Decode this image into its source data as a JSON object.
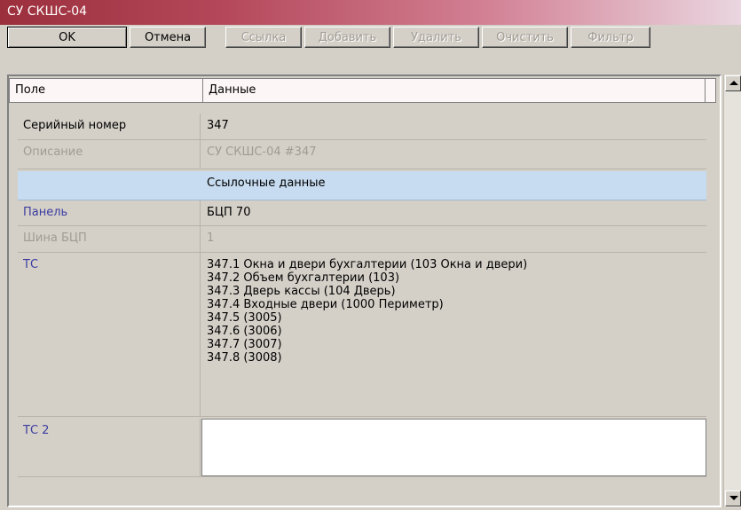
{
  "window": {
    "title": "СУ СКШС-04"
  },
  "toolbar": {
    "ok": "OK",
    "cancel": "Отмена",
    "link": "Ссылка",
    "add": "Добавить",
    "delete": "Удалить",
    "clear": "Очистить",
    "filter": "Фильтр"
  },
  "grid": {
    "header": {
      "field": "Поле",
      "data": "Данные"
    },
    "rows": {
      "serial": {
        "field": "Серийный номер",
        "value": "347"
      },
      "description": {
        "field": "Описание",
        "value": "СУ СКШС-04 #347"
      },
      "section": {
        "label": "Ссылочные данные"
      },
      "panel": {
        "field": "Панель",
        "value": "БЦП 70"
      },
      "bus": {
        "field": "Шина БЦП",
        "value": "1"
      },
      "tc": {
        "field": "ТС",
        "items": [
          "347.1 Окна и двери бухгалтерии (103 Окна и двери)",
          "347.2 Объем бухгалтерии (103)",
          "347.3 Дверь кассы (104 Дверь)",
          "347.4 Входные двери (1000 Периметр)",
          "347.5 (3005)",
          "347.6 (3006)",
          "347.7 (3007)",
          "347.8 (3008)"
        ]
      },
      "tc2": {
        "field": "ТС 2",
        "value": ""
      }
    }
  },
  "colors": {
    "title_gradient_start": "#9c2f3c",
    "section_bg": "#c7dcf0",
    "header_bg": "#fdf6f6",
    "disabled_text": "#a09c94",
    "link_field_text": "#3c3ca0"
  }
}
